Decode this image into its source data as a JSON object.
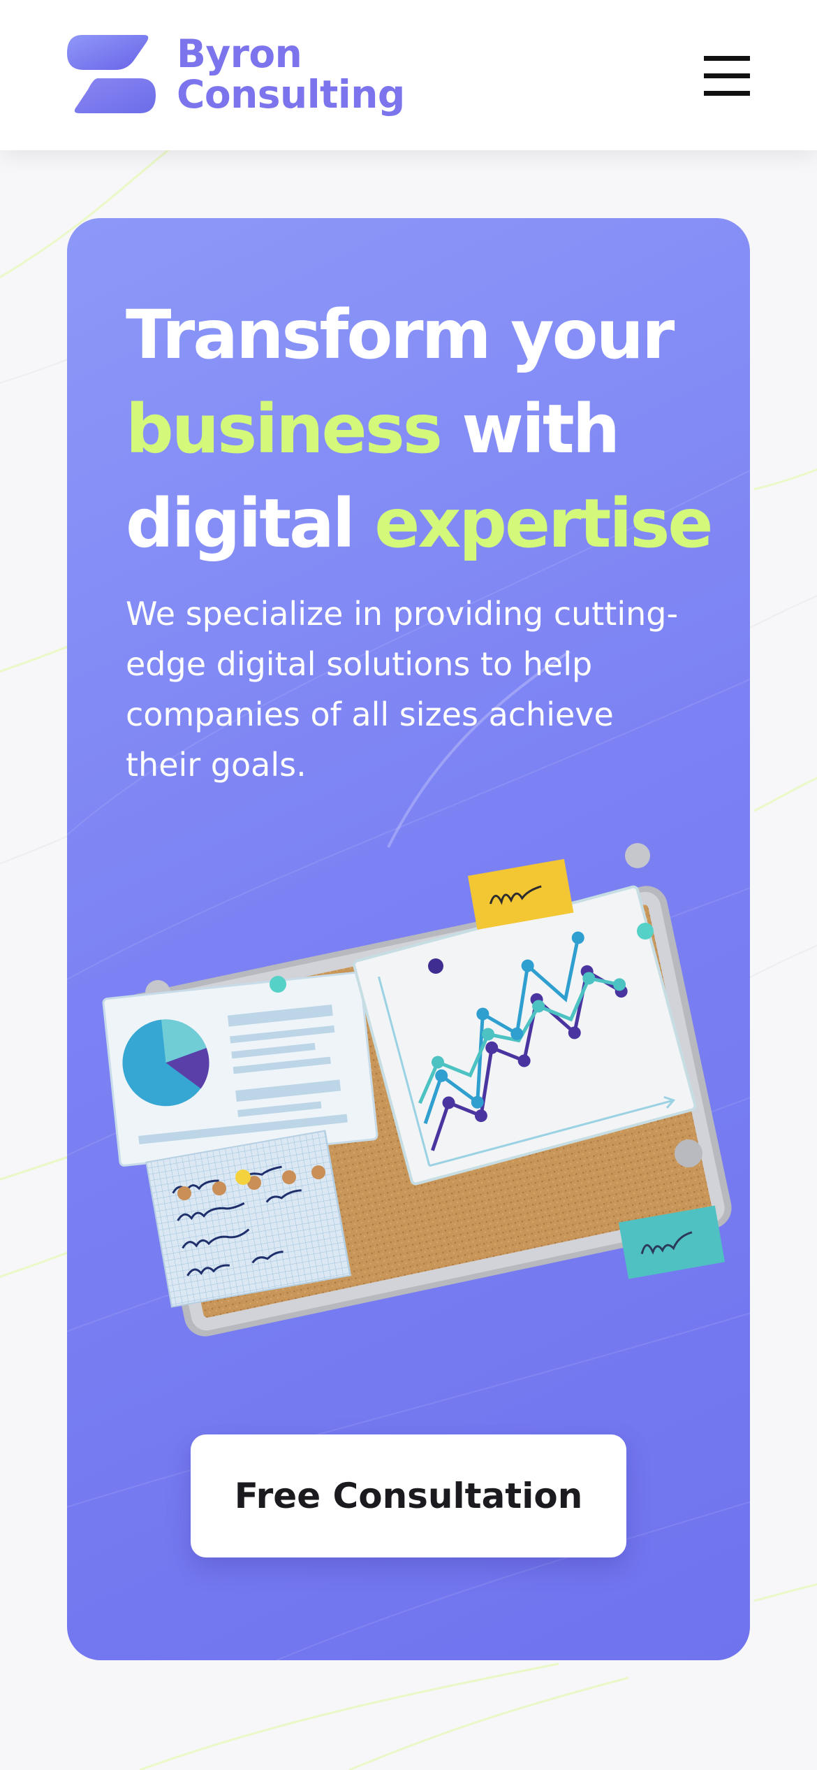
{
  "header": {
    "brand_line1": "Byron",
    "brand_line2": "Consulting",
    "menu_icon": "hamburger-menu-icon"
  },
  "hero": {
    "title_part1": "Transform your ",
    "title_accent1": "business",
    "title_part2": " with digital ",
    "title_accent2": "expertise",
    "subtitle": "We specialize in providing cutting-edge digital solutions to help companies of all sizes achieve their goals.",
    "illustration": "corkboard-with-charts-illustration",
    "cta_label": "Free Consultation"
  },
  "colors": {
    "brand": "#7b74ec",
    "hero_gradient_start": "#8c98f8",
    "hero_gradient_end": "#6f73ee",
    "accent": "#d4f97a",
    "cta_text": "#1b1b1f"
  }
}
